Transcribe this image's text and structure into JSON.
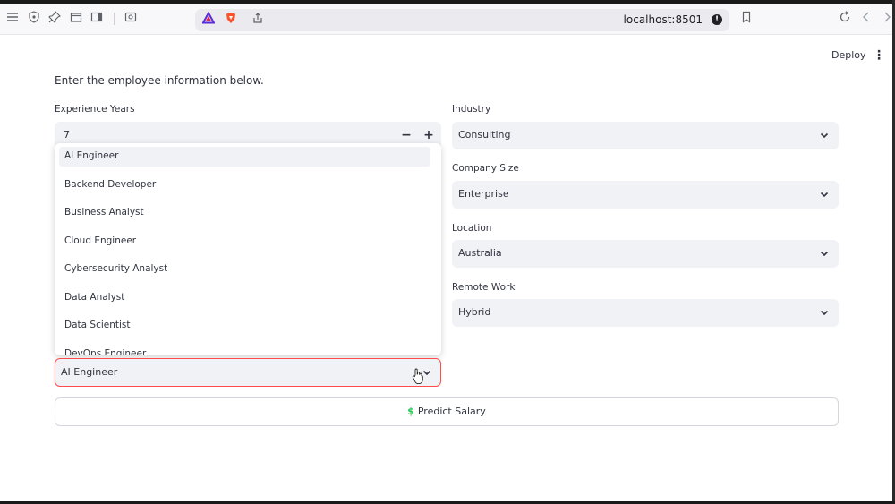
{
  "browser": {
    "url": "localhost:8501"
  },
  "header": {
    "deploy_label": "Deploy"
  },
  "form": {
    "intro": "Enter the employee information below.",
    "experience": {
      "label": "Experience Years",
      "value": "7"
    },
    "industry": {
      "label": "Industry",
      "value": "Consulting"
    },
    "company_size": {
      "label": "Company Size",
      "value": "Enterprise"
    },
    "location": {
      "label": "Location",
      "value": "Australia"
    },
    "remote_work": {
      "label": "Remote Work",
      "value": "Hybrid"
    },
    "job_title": {
      "value": "AI Engineer",
      "options": [
        "AI Engineer",
        "Backend Developer",
        "Business Analyst",
        "Cloud Engineer",
        "Cybersecurity Analyst",
        "Data Analyst",
        "Data Scientist",
        "DevOps Engineer"
      ]
    },
    "predict_label": "Predict Salary"
  },
  "colors": {
    "accent_red": "#ff4b4b",
    "success_green": "#21c354"
  }
}
